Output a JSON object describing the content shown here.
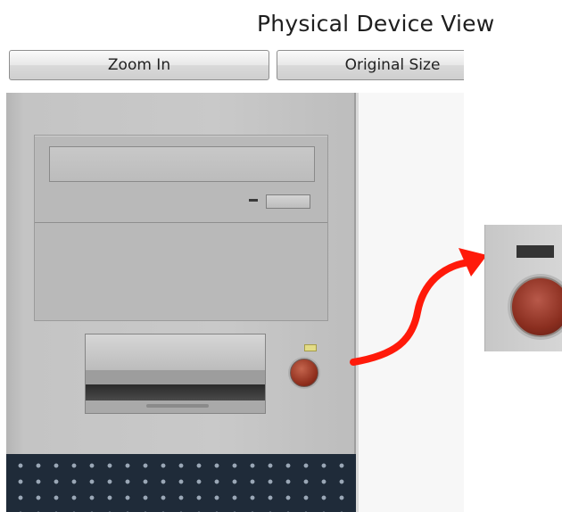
{
  "header": {
    "title": "Physical Device View"
  },
  "toolbar": {
    "zoom_in_label": "Zoom In",
    "original_size_label": "Original Size"
  },
  "colors": {
    "power_button": "#8f2e1c",
    "power_led": "#e3dc86",
    "callout_arrow": "#ff1a0a",
    "vent_grille": "#1f2b39"
  },
  "icons": {
    "arrow": "curved-callout-arrow-icon",
    "power": "power-button-icon"
  }
}
